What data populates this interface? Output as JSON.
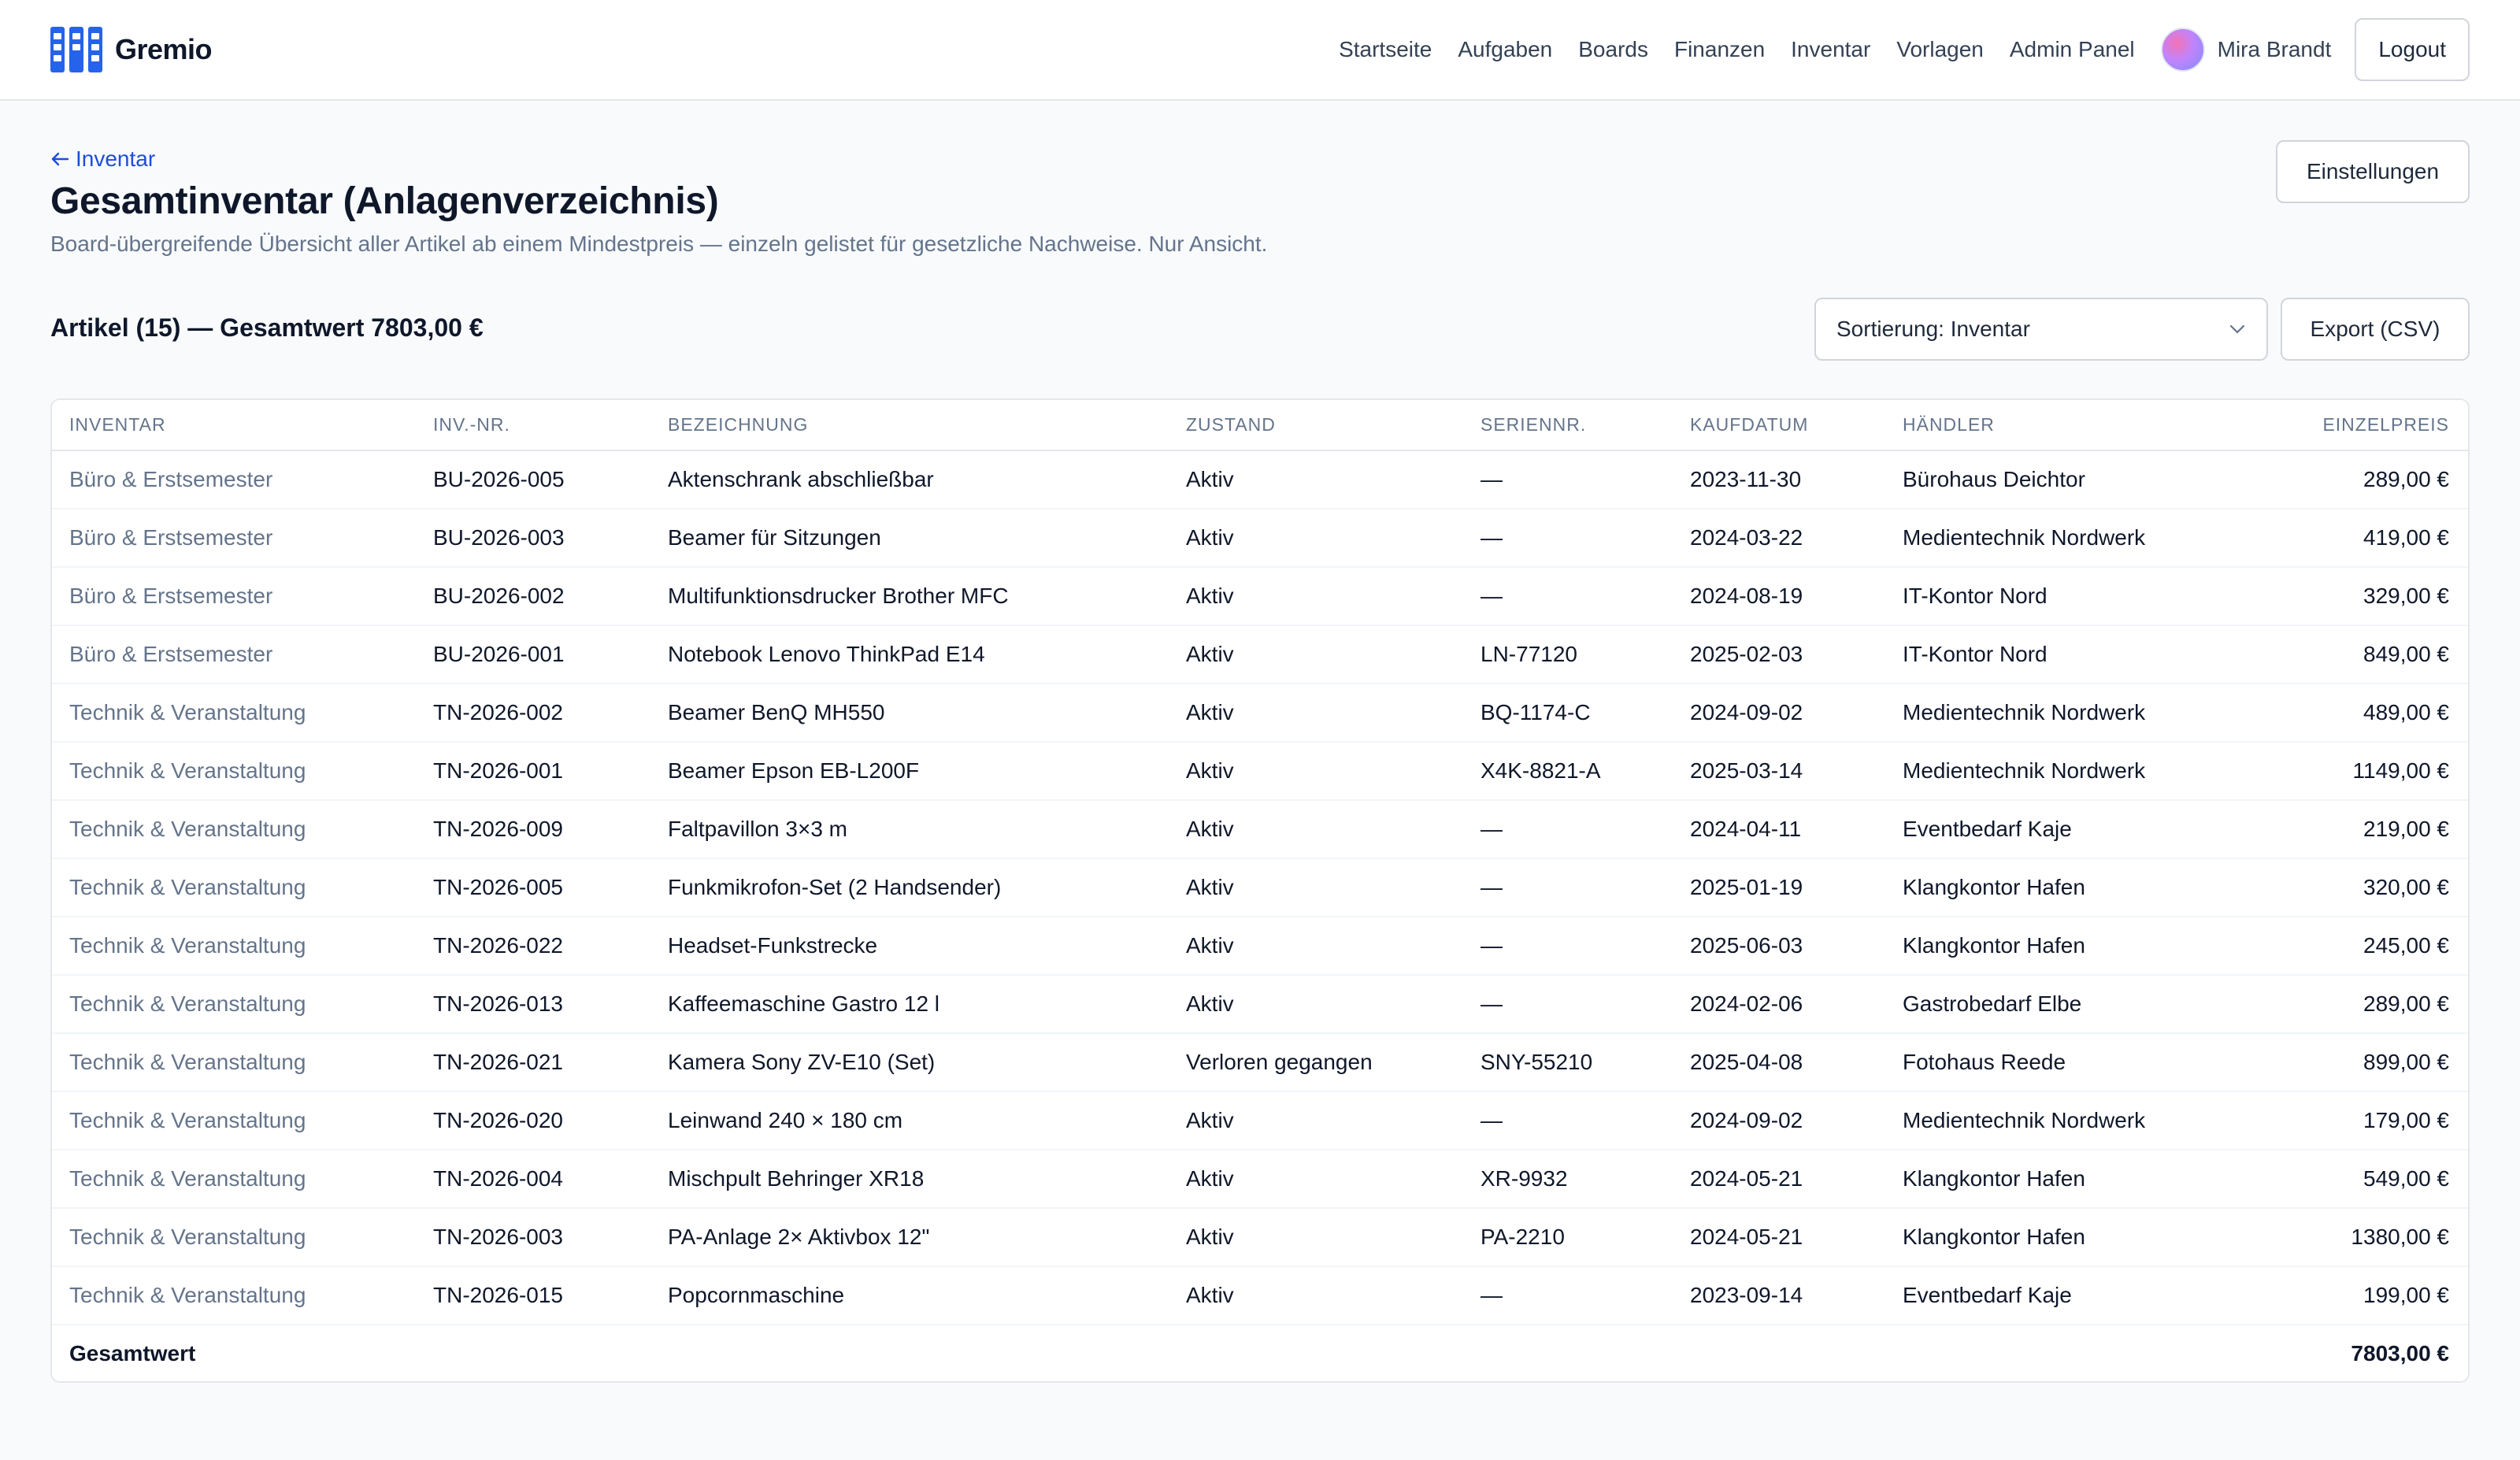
{
  "brand": {
    "name": "Gremio"
  },
  "nav": {
    "links": [
      "Startseite",
      "Aufgaben",
      "Boards",
      "Finanzen",
      "Inventar",
      "Vorlagen",
      "Admin Panel"
    ],
    "user_name": "Mira Brandt",
    "logout_label": "Logout"
  },
  "header": {
    "back_label": "Inventar",
    "title": "Gesamtinventar (Anlagenverzeichnis)",
    "subtitle": "Board-übergreifende Übersicht aller Artikel ab einem Mindestpreis — einzeln gelistet für gesetzliche Nachweise. Nur Ansicht.",
    "settings_label": "Einstellungen"
  },
  "summary": {
    "text": "Artikel (15) — Gesamtwert 7803,00 €",
    "sort_label": "Sortierung: Inventar",
    "export_label": "Export (CSV)"
  },
  "table": {
    "columns": [
      "INVENTAR",
      "INV.-NR.",
      "BEZEICHNUNG",
      "ZUSTAND",
      "SERIENNR.",
      "KAUFDATUM",
      "HÄNDLER",
      "EINZELPREIS"
    ],
    "rows": [
      [
        "Büro & Erstsemester",
        "BU-2026-005",
        "Aktenschrank abschließbar",
        "Aktiv",
        "—",
        "2023-11-30",
        "Bürohaus Deichtor",
        "289,00 €"
      ],
      [
        "Büro & Erstsemester",
        "BU-2026-003",
        "Beamer für Sitzungen",
        "Aktiv",
        "—",
        "2024-03-22",
        "Medientechnik Nordwerk",
        "419,00 €"
      ],
      [
        "Büro & Erstsemester",
        "BU-2026-002",
        "Multifunktionsdrucker Brother MFC",
        "Aktiv",
        "—",
        "2024-08-19",
        "IT-Kontor Nord",
        "329,00 €"
      ],
      [
        "Büro & Erstsemester",
        "BU-2026-001",
        "Notebook Lenovo ThinkPad E14",
        "Aktiv",
        "LN-77120",
        "2025-02-03",
        "IT-Kontor Nord",
        "849,00 €"
      ],
      [
        "Technik & Veranstaltung",
        "TN-2026-002",
        "Beamer BenQ MH550",
        "Aktiv",
        "BQ-1174-C",
        "2024-09-02",
        "Medientechnik Nordwerk",
        "489,00 €"
      ],
      [
        "Technik & Veranstaltung",
        "TN-2026-001",
        "Beamer Epson EB-L200F",
        "Aktiv",
        "X4K-8821-A",
        "2025-03-14",
        "Medientechnik Nordwerk",
        "1149,00 €"
      ],
      [
        "Technik & Veranstaltung",
        "TN-2026-009",
        "Faltpavillon 3×3 m",
        "Aktiv",
        "—",
        "2024-04-11",
        "Eventbedarf Kaje",
        "219,00 €"
      ],
      [
        "Technik & Veranstaltung",
        "TN-2026-005",
        "Funkmikrofon-Set (2 Handsender)",
        "Aktiv",
        "—",
        "2025-01-19",
        "Klangkontor Hafen",
        "320,00 €"
      ],
      [
        "Technik & Veranstaltung",
        "TN-2026-022",
        "Headset-Funkstrecke",
        "Aktiv",
        "—",
        "2025-06-03",
        "Klangkontor Hafen",
        "245,00 €"
      ],
      [
        "Technik & Veranstaltung",
        "TN-2026-013",
        "Kaffeemaschine Gastro 12 l",
        "Aktiv",
        "—",
        "2024-02-06",
        "Gastrobedarf Elbe",
        "289,00 €"
      ],
      [
        "Technik & Veranstaltung",
        "TN-2026-021",
        "Kamera Sony ZV-E10 (Set)",
        "Verloren gegangen",
        "SNY-55210",
        "2025-04-08",
        "Fotohaus Reede",
        "899,00 €"
      ],
      [
        "Technik & Veranstaltung",
        "TN-2026-020",
        "Leinwand 240 × 180 cm",
        "Aktiv",
        "—",
        "2024-09-02",
        "Medientechnik Nordwerk",
        "179,00 €"
      ],
      [
        "Technik & Veranstaltung",
        "TN-2026-004",
        "Mischpult Behringer XR18",
        "Aktiv",
        "XR-9932",
        "2024-05-21",
        "Klangkontor Hafen",
        "549,00 €"
      ],
      [
        "Technik & Veranstaltung",
        "TN-2026-003",
        "PA-Anlage 2× Aktivbox 12\"",
        "Aktiv",
        "PA-2210",
        "2024-05-21",
        "Klangkontor Hafen",
        "1380,00 €"
      ],
      [
        "Technik & Veranstaltung",
        "TN-2026-015",
        "Popcornmaschine",
        "Aktiv",
        "—",
        "2023-09-14",
        "Eventbedarf Kaje",
        "199,00 €"
      ]
    ],
    "total_label": "Gesamtwert",
    "total_value": "7803,00 €"
  },
  "icons": {
    "logo": "board-grid-icon",
    "back": "arrow-left-icon",
    "sort_toggle": "chevron-down-icon"
  },
  "colors": {
    "accent_link": "#1d4ed8",
    "logo_blue": "#2563eb",
    "muted_text": "#64748b"
  }
}
